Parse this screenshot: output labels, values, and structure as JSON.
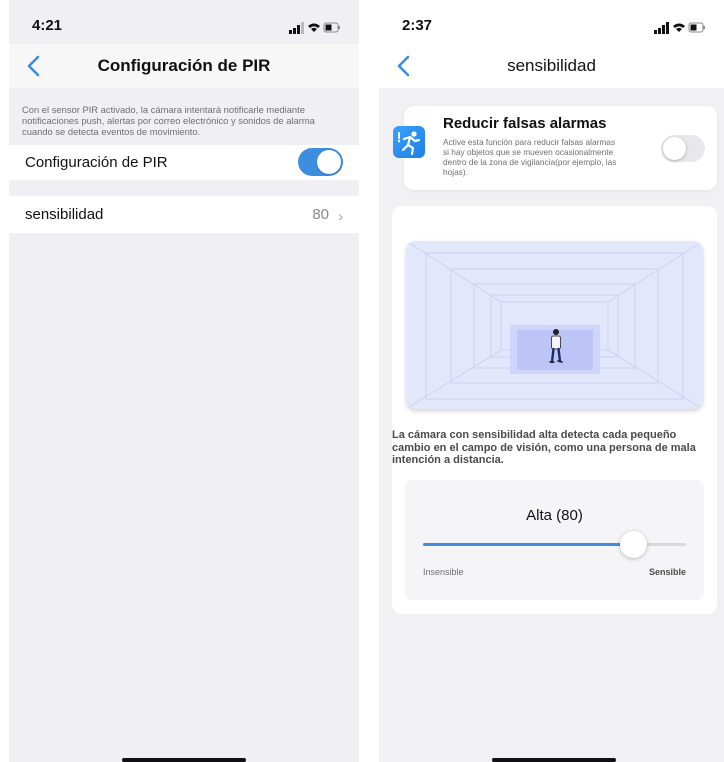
{
  "screen_left": {
    "status": {
      "time": "4:21"
    },
    "nav": {
      "title": "Configuración de PIR",
      "back_icon": "chevron-left-icon"
    },
    "description": "Con el sensor PIR activado, la cámara intentará notificarle mediante notificaciones push, alertas por correo electrónico y sonidos de alarma cuando se detecta eventos de movimiento.",
    "pir_row": {
      "label": "Configuración de PIR",
      "enabled": true
    },
    "sensitivity_row": {
      "label": "sensibilidad",
      "value": "80",
      "chevron": "›"
    }
  },
  "screen_right": {
    "status": {
      "time": "2:37"
    },
    "nav": {
      "title": "sensibilidad",
      "back_icon": "chevron-left-icon"
    },
    "false_alarms": {
      "title": "Reducir falsas alarmas",
      "description": "Active esta función para reducir falsas alarmas si hay objetos que se mueven ocasionalmente dentro de la zona de vigilancia(por ejemplo, las hojas).",
      "enabled": false,
      "icon": "running-person-icon"
    },
    "sensitivity": {
      "illustration": "corridor-person-illustration",
      "explanation": "La cámara con sensibilidad alta detecta cada pequeño cambio en el campo de visión, como una persona de mala intención a distancia.",
      "slider_title": "Alta (80)",
      "value": 80,
      "min_label": "Insensible",
      "max_label": "Sensible"
    }
  },
  "colors": {
    "accent": "#3d8ee0",
    "background_grouped": "#efeff4",
    "toggle_off": "#e8e8ea"
  }
}
